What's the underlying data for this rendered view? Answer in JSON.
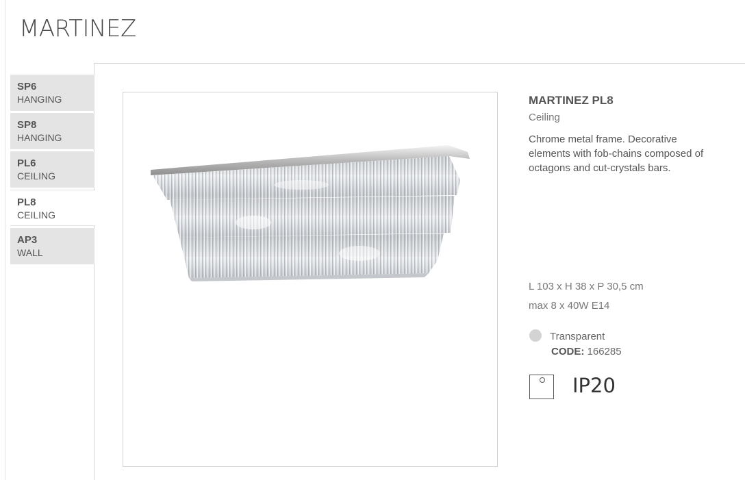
{
  "page": {
    "title": "MARTINEZ"
  },
  "tabs": [
    {
      "code": "SP6",
      "type": "HANGING",
      "active": false
    },
    {
      "code": "SP8",
      "type": "HANGING",
      "active": false
    },
    {
      "code": "PL6",
      "type": "CEILING",
      "active": false
    },
    {
      "code": "PL8",
      "type": "CEILING",
      "active": true
    },
    {
      "code": "AP3",
      "type": "WALL",
      "active": false
    }
  ],
  "product": {
    "name": "MARTINEZ PL8",
    "type": "Ceiling",
    "description": "Chrome metal frame. Decorative elements with fob-chains composed of octagons and cut-crystals bars.",
    "dimensions": "L 103 x H 38 x P 30,5 cm",
    "bulbs": "max 8 x 40W E14",
    "finish": {
      "name": "Transparent",
      "color": "#d3d3d3"
    },
    "code_label": "CODE:",
    "code": "166285",
    "ip_rating": "IP20",
    "image_icon": "crystal-ceiling-lamp"
  }
}
